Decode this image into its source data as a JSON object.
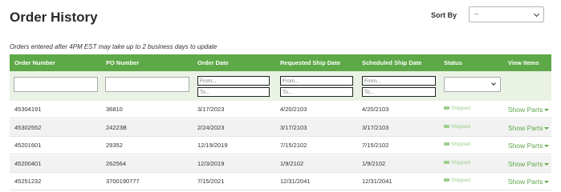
{
  "header": {
    "title": "Order History",
    "sort_label": "Sort By",
    "sort_value": "--"
  },
  "note": "Orders entered after 4PM EST may take up to 2 business days to update",
  "table": {
    "columns": [
      "Order Number",
      "PO Number",
      "Order Date",
      "Requested Ship Date",
      "Scheduled Ship Date",
      "Status",
      "View Items"
    ],
    "filters": {
      "from_placeholder": "From...",
      "to_placeholder": "To..."
    },
    "rows": [
      {
        "order": "45304191",
        "po": "36810",
        "order_date": "3/17/2023",
        "requested": "4/20/2103",
        "scheduled": "4/20/2103",
        "status": "Shipped",
        "action": "Show Parts"
      },
      {
        "order": "45302552",
        "po": "24223B",
        "order_date": "2/24/2023",
        "requested": "3/17/2103",
        "scheduled": "3/17/2103",
        "status": "Shipped",
        "action": "Show Parts"
      },
      {
        "order": "45201601",
        "po": "29352",
        "order_date": "12/19/2019",
        "requested": "7/15/2102",
        "scheduled": "7/15/2102",
        "status": "Shipped",
        "action": "Show Parts"
      },
      {
        "order": "45200401",
        "po": "262564",
        "order_date": "12/3/2019",
        "requested": "1/9/2102",
        "scheduled": "1/9/2102",
        "status": "Shipped",
        "action": "Show Parts"
      },
      {
        "order": "45251232",
        "po": "3700190777",
        "order_date": "7/15/2021",
        "requested": "12/31/2041",
        "scheduled": "12/31/2041",
        "status": "Shipped",
        "action": "Show Parts"
      }
    ]
  },
  "colors": {
    "header_green": "#5da847",
    "filter_bg": "#e9f2e4",
    "status_green": "#9ccf8c"
  }
}
